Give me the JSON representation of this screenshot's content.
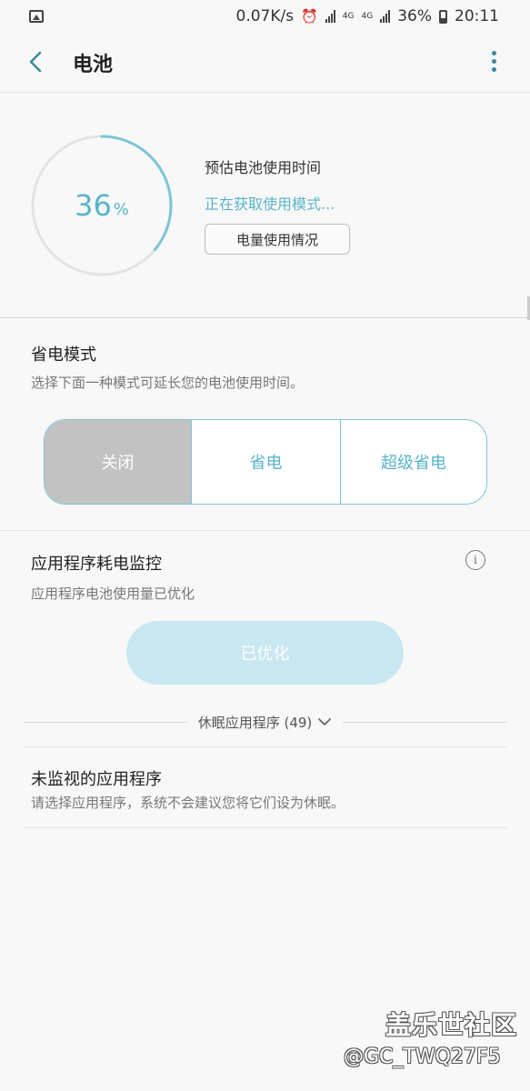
{
  "status_bar": {
    "net_speed": "0.07K/s",
    "network_4g_a": "4G",
    "network_4g_b": "4G",
    "battery_pct": "36%",
    "time": "20:11"
  },
  "header": {
    "title": "电池"
  },
  "battery": {
    "percent_value": 36,
    "percent_number": "36",
    "percent_sign": "%",
    "estimate_label": "预估电池使用时间",
    "status_text": "正在获取使用模式...",
    "usage_button_label": "电量使用情况"
  },
  "power_saving": {
    "title": "省电模式",
    "description": "选择下面一种模式可延长您的电池使用时间。",
    "options": [
      "关闭",
      "省电",
      "超级省电"
    ],
    "selected": "关闭"
  },
  "app_monitor": {
    "title": "应用程序耗电监控",
    "description": "应用程序电池使用量已优化",
    "optimized_button": "已优化",
    "sleeping_apps_label": "休眠应用程序 (49)"
  },
  "unmonitored": {
    "title": "未监视的应用程序",
    "description": "请选择应用程序，系统不会建议您将它们设为休眠。"
  },
  "watermark": {
    "line1": "盖乐世社区",
    "line2": "@GC_TWQ27F5"
  },
  "colors": {
    "accent": "#5ab4c8",
    "ring_track": "#e3e3e3",
    "segment_active": "#c2c2c2",
    "optimized_bg": "#c8e7f0"
  },
  "icons": {
    "back": "back-arrow-icon",
    "more": "more-vert-icon",
    "info": "info-icon",
    "expand": "chevron-down-icon"
  }
}
